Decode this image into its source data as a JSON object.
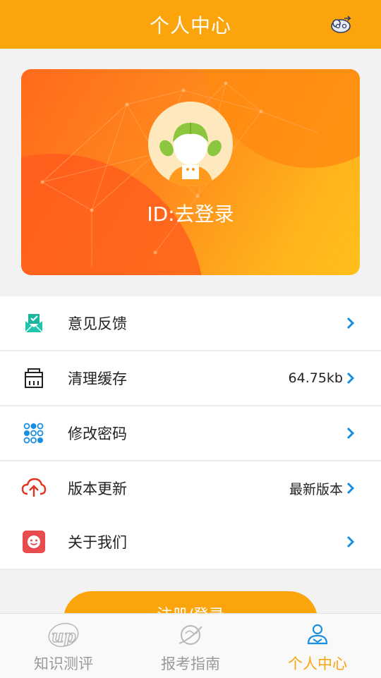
{
  "header": {
    "title": "个人中心",
    "settings_icon": "settings-cloud-icon"
  },
  "profile": {
    "id_text": "ID:去登录",
    "avatar": "girl-avatar"
  },
  "menu": [
    {
      "label": "意见反馈",
      "value": "",
      "icon": "feedback-envelope-icon",
      "icon_color": "#1db5a0"
    },
    {
      "label": "清理缓存",
      "value": "64.75kb",
      "icon": "cache-box-icon",
      "icon_color": "#222222"
    },
    {
      "label": "修改密码",
      "value": "",
      "icon": "password-keypad-icon",
      "icon_color": "#1a8ee0"
    },
    {
      "label": "版本更新",
      "value": "最新版本",
      "icon": "cloud-upload-icon",
      "icon_color": "#e0341c"
    }
  ],
  "menu2": [
    {
      "label": "关于我们",
      "value": "",
      "icon": "smiley-face-icon",
      "icon_color": "#e84c4c"
    }
  ],
  "login_button": {
    "label": "注册/登录"
  },
  "tabs": [
    {
      "label": "知识测评",
      "icon": "up-logo-icon",
      "active": false
    },
    {
      "label": "报考指南",
      "icon": "compass-planet-icon",
      "active": false
    },
    {
      "label": "个人中心",
      "icon": "person-icon",
      "active": true
    }
  ],
  "colors": {
    "accent": "#fca40c",
    "chevron": "#1a8ee0"
  }
}
